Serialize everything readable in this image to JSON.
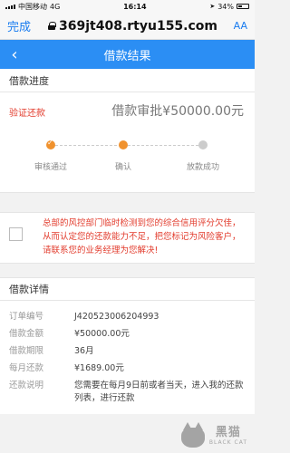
{
  "status_bar": {
    "carrier": "中国移动",
    "network": "4G",
    "time": "16:14",
    "battery": "34%"
  },
  "browser": {
    "done_label": "完成",
    "url": "369jt408.rtyu155.com",
    "text_size_label": "AA"
  },
  "header": {
    "title": "借款结果"
  },
  "progress": {
    "section_title": "借款进度",
    "verify_label": "验证还款",
    "approval_text": "借款审批¥50000.00元",
    "steps": [
      {
        "label": "审核通过",
        "state": "done"
      },
      {
        "label": "确认",
        "state": "current"
      },
      {
        "label": "放款成功",
        "state": "pending"
      }
    ]
  },
  "notice": {
    "text": "总部的风控部门临时检测到您的综合信用评分欠佳，从而认定您的还款能力不足，把您标记为风险客户，请联系您的业务经理为您解决!"
  },
  "details": {
    "section_title": "借款详情",
    "rows": [
      {
        "label": "订单编号",
        "value": "J420523006204993"
      },
      {
        "label": "借款金额",
        "value": "¥50000.00元"
      },
      {
        "label": "借款期限",
        "value": "36月"
      },
      {
        "label": "每月还款",
        "value": "¥1689.00元"
      },
      {
        "label": "还款说明",
        "value": "您需要在每月9日前或者当天，进入我的还款列表，进行还款"
      }
    ]
  },
  "watermark": {
    "cn": "黑猫",
    "en": "BLACK CAT"
  },
  "colors": {
    "accent": "#2b8ef4",
    "warning": "#e23b2c",
    "step_active": "#f0922e"
  }
}
